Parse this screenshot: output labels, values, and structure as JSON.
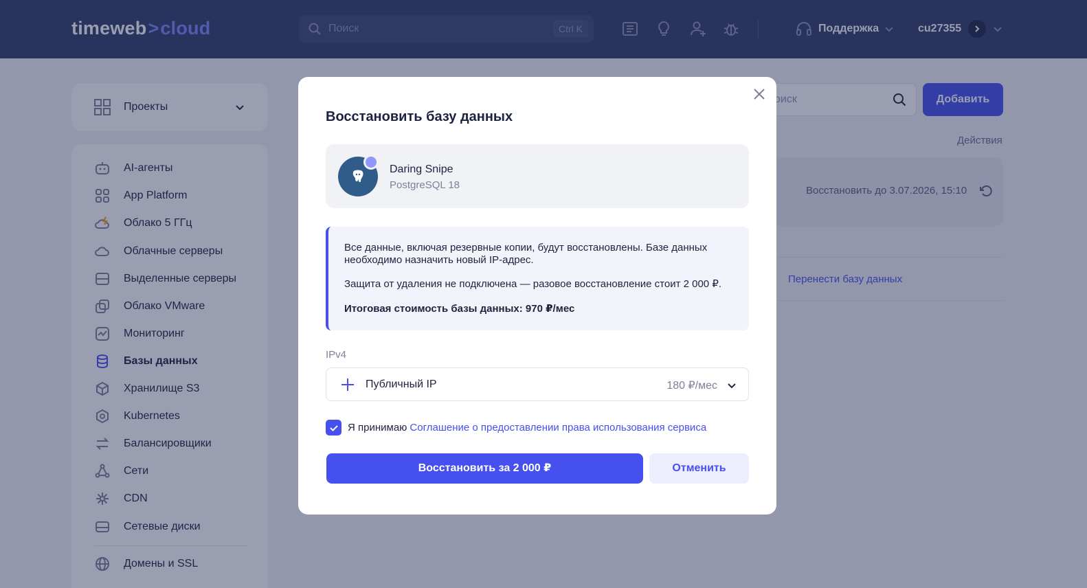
{
  "header": {
    "logo_main": "timeweb",
    "logo_arrow": ">",
    "logo_sub": "cloud",
    "search_placeholder": "Поиск",
    "search_shortcut": "Ctrl K",
    "support_label": "Поддержка",
    "user_label": "cu27355"
  },
  "sidebar": {
    "projects_label": "Проекты",
    "items": [
      {
        "label": "AI-агенты",
        "icon": "bot-icon"
      },
      {
        "label": "App Platform",
        "icon": "apps-grid-icon"
      },
      {
        "label": "Облако 5 ГГц",
        "icon": "cloud-lightning-icon"
      },
      {
        "label": "Облачные серверы",
        "icon": "cloud-icon"
      },
      {
        "label": "Выделенные серверы",
        "icon": "server-icon"
      },
      {
        "label": "Облако VMware",
        "icon": "vmware-icon"
      },
      {
        "label": "Мониторинг",
        "icon": "monitoring-icon"
      },
      {
        "label": "Базы данных",
        "icon": "database-icon"
      },
      {
        "label": "Хранилище S3",
        "icon": "storage-cube-icon"
      },
      {
        "label": "Kubernetes",
        "icon": "kubernetes-icon"
      },
      {
        "label": "Балансировщики",
        "icon": "balancer-arrows-icon"
      },
      {
        "label": "Сети",
        "icon": "network-icon"
      },
      {
        "label": "CDN",
        "icon": "cdn-icon"
      },
      {
        "label": "Сетевые диски",
        "icon": "disk-icon"
      },
      {
        "label": "Домены и SSL",
        "icon": "globe-icon"
      }
    ]
  },
  "background": {
    "search_placeholder": "оиск",
    "add_button": "Добавить",
    "actions_header": "Действия",
    "restore_until": "Восстановить до 3.07.2026, 15:10",
    "migrate_link": "Перенести базу данных"
  },
  "modal": {
    "title": "Восстановить базу данных",
    "db_name": "Daring Snipe",
    "db_version": "PostgreSQL 18",
    "info_p1": "Все данные, включая резервные копии, будут восстановлены. Базе данных необходимо назначить новый IP-адрес.",
    "info_p2": "Защита от удаления не подключена — разовое восстановление стоит 2 000 ₽.",
    "info_p3": "Итоговая стоимость базы данных: 970 ₽/мес",
    "ip_label": "IPv4",
    "ip_option": "Публичный IP",
    "ip_price": "180 ₽/мес",
    "agree_prefix": "Я принимаю",
    "agree_link": "Соглашение о предоставлении права использования сервиса",
    "agree_checked": true,
    "restore_button": "Восстановить за 2 000 ₽",
    "cancel_button": "Отменить"
  },
  "colors": {
    "header_bg": "#303c6a",
    "accent": "#4550ef",
    "overlay": "rgba(30,40,80,0.45)"
  }
}
